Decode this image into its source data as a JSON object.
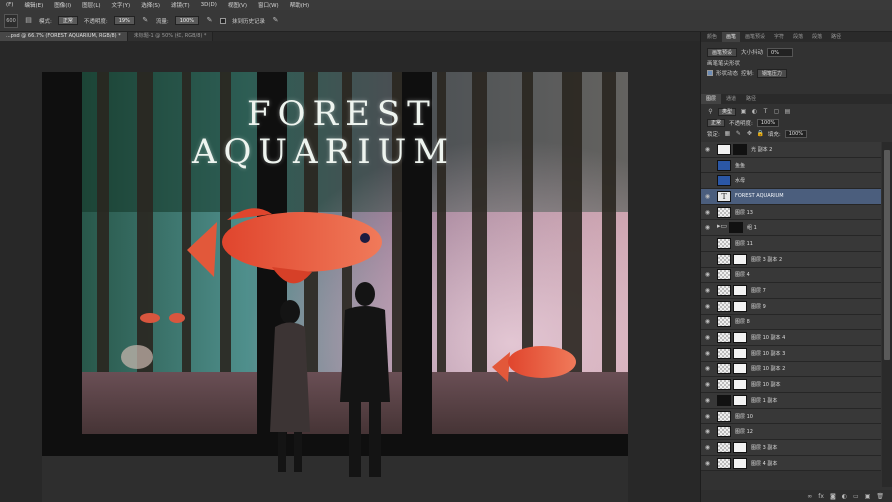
{
  "menu": [
    "(F)",
    "编辑(E)",
    "图像(I)",
    "图层(L)",
    "文字(Y)",
    "选择(S)",
    "滤镜(T)",
    "3D(D)",
    "视图(V)",
    "窗口(W)",
    "帮助(H)"
  ],
  "options": {
    "size": "600",
    "mode_label": "模式:",
    "mode_value": "正常",
    "opacity_label": "不透明度:",
    "opacity_value": "19%",
    "flow_label": "流量:",
    "flow_value": "100%",
    "history_label": "抹到历史记录"
  },
  "doc_tabs": [
    {
      "label": "...psd @ 66.7% (FOREST AQUARIUM, RGB/8) *",
      "active": true
    },
    {
      "label": "未标题-1 @ 50% (红, RGB/8) *",
      "active": false
    }
  ],
  "poster": {
    "line1": "FOREST",
    "line2": "AQUARIUM"
  },
  "panel_tabs": [
    "颜色",
    "画笔",
    "画笔预设",
    "字符",
    "段落",
    "段落",
    "路径"
  ],
  "panel_tab_active": 1,
  "brush": {
    "preset_btn": "画笔预设",
    "size_label": "大小抖动",
    "size_value": "0%",
    "tip_label": "画笔笔尖形状",
    "dynamics_label": "形状动态",
    "control_label": "控制:",
    "control_value": "钢笔压力"
  },
  "layer_tabs": [
    "图层",
    "通道",
    "路径"
  ],
  "layer_controls": {
    "kind_value": "类型",
    "blend_value": "正常",
    "opacity_label": "不透明度:",
    "opacity_value": "100%",
    "lock_label": "锁定:",
    "fill_label": "填充:",
    "fill_value": "100%"
  },
  "layers": [
    {
      "name": "光 副本 2",
      "thumb": "white",
      "mask": "dark",
      "eye": true,
      "selected": false
    },
    {
      "name": "鱼鱼",
      "thumb": "blue",
      "mask": null,
      "eye": false,
      "selected": false
    },
    {
      "name": "水母",
      "thumb": "blue",
      "mask": null,
      "eye": false,
      "selected": false
    },
    {
      "name": "FOREST AQUARIUM",
      "thumb": "text",
      "mask": null,
      "eye": true,
      "selected": true
    },
    {
      "name": "图层 13",
      "thumb": "check",
      "mask": null,
      "eye": true,
      "selected": false
    },
    {
      "name": "组 1",
      "thumb": "folder",
      "mask": "dark",
      "eye": true,
      "selected": false
    },
    {
      "name": "图层 11",
      "thumb": "check",
      "mask": null,
      "eye": false,
      "selected": false
    },
    {
      "name": "图层 3 副本 2",
      "thumb": "check",
      "mask": "white",
      "eye": false,
      "selected": false
    },
    {
      "name": "图层 4",
      "thumb": "check",
      "mask": null,
      "eye": true,
      "selected": false
    },
    {
      "name": "图层 7",
      "thumb": "check",
      "mask": "white",
      "eye": true,
      "selected": false
    },
    {
      "name": "图层 9",
      "thumb": "check",
      "mask": "white",
      "eye": true,
      "selected": false
    },
    {
      "name": "图层 8",
      "thumb": "check",
      "mask": null,
      "eye": true,
      "selected": false
    },
    {
      "name": "图层 10 副本 4",
      "thumb": "check",
      "mask": "white",
      "eye": true,
      "selected": false
    },
    {
      "name": "图层 10 副本 3",
      "thumb": "check",
      "mask": "white",
      "eye": true,
      "selected": false
    },
    {
      "name": "图层 10 副本 2",
      "thumb": "check",
      "mask": "white",
      "eye": true,
      "selected": false
    },
    {
      "name": "图层 10 副本",
      "thumb": "check",
      "mask": "white",
      "eye": true,
      "selected": false
    },
    {
      "name": "图层 1 副本",
      "thumb": "dark",
      "mask": "white",
      "eye": true,
      "selected": false
    },
    {
      "name": "图层 10",
      "thumb": "check",
      "mask": null,
      "eye": true,
      "selected": false
    },
    {
      "name": "图层 12",
      "thumb": "check",
      "mask": null,
      "eye": true,
      "selected": false
    },
    {
      "name": "图层 3 副本",
      "thumb": "check",
      "mask": "white",
      "eye": true,
      "selected": false
    },
    {
      "name": "图层 4 副本",
      "thumb": "check",
      "mask": "white",
      "eye": true,
      "selected": false
    }
  ],
  "footer_icons": [
    "link-icon",
    "fx-icon",
    "mask-icon",
    "adjustment-icon",
    "folder-icon",
    "new-layer-icon",
    "trash-icon"
  ]
}
